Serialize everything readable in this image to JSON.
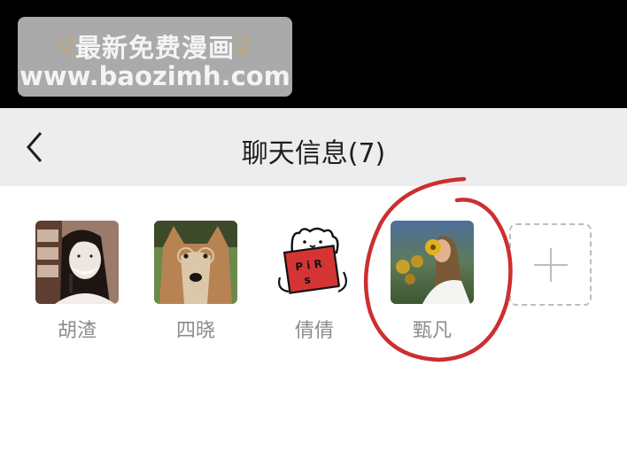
{
  "watermark": {
    "line1": "最新免费漫画",
    "line2": "www.baozimh.com",
    "hand_icon": "pointing-down-hand"
  },
  "header": {
    "title": "聊天信息(7)",
    "back_icon": "chevron-left-icon"
  },
  "members": [
    {
      "name": "胡渣",
      "avatar": "manga-woman-avatar"
    },
    {
      "name": "四晓",
      "avatar": "dog-with-glasses-avatar"
    },
    {
      "name": "倩倩",
      "avatar": "cartoon-bear-reading-avatar"
    },
    {
      "name": "甄凡",
      "avatar": "girl-with-sunflower-avatar"
    }
  ],
  "add_member": {
    "icon": "plus-icon"
  },
  "annotation": {
    "color": "#cc2f2f",
    "shape": "hand-drawn-circle"
  },
  "colors": {
    "header_bg": "#ededed",
    "name_text": "#8c8c8c",
    "title_text": "#1e1e1e"
  }
}
